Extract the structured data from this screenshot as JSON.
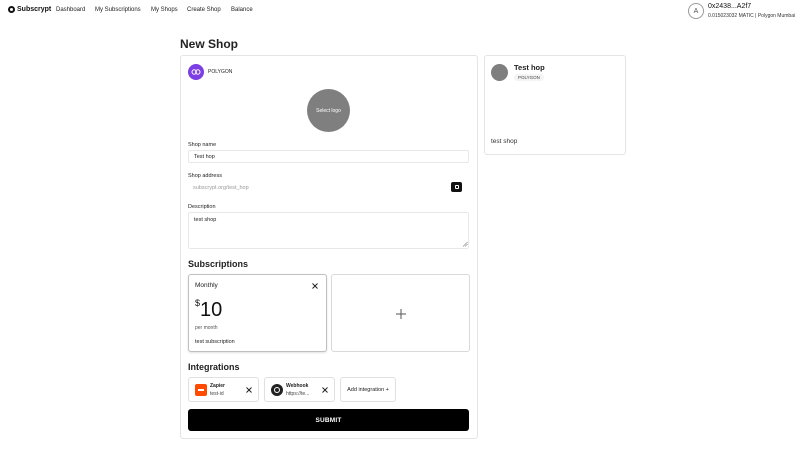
{
  "nav": {
    "brand": "Subscrypt",
    "links": [
      "Dashboard",
      "My Subscriptions",
      "My Shops",
      "Create Shop",
      "Balance"
    ]
  },
  "wallet": {
    "avatar_letter": "A",
    "address": "0x2438...A2f7",
    "balance": "0.0150230​32 MATIC | Polygon Mumbai"
  },
  "page": {
    "title": "New Shop"
  },
  "form": {
    "chain_name": "POLYGON",
    "select_logo": "Select logo",
    "shop_name_label": "Shop name",
    "shop_name_value": "Test hop",
    "shop_address_label": "Shop address",
    "shop_address_value": "subscrypt.org/test_hop",
    "description_label": "Description",
    "description_value": "test shop"
  },
  "subscriptions": {
    "title": "Subscriptions",
    "items": [
      {
        "name": "Monthly",
        "currency": "$",
        "amount": "10",
        "period": "per month",
        "description": "test subscription"
      }
    ],
    "add_icon": "plus-icon"
  },
  "integrations": {
    "title": "Integrations",
    "items": [
      {
        "name": "Zapier",
        "value": "test-id",
        "icon": "zapier-icon"
      },
      {
        "name": "Webhook",
        "value": "https://te...",
        "icon": "webhook-icon"
      }
    ],
    "add_label": "Add integration +"
  },
  "submit_label": "SUBMIT",
  "preview": {
    "name": "Test hop",
    "chain": "POLYGON",
    "description": "test shop"
  },
  "colors": {
    "polygon_purple": "#7b3fe4",
    "zapier_orange": "#ff4a00",
    "submit_black": "#000000",
    "logo_gray": "#7f7f7f"
  }
}
